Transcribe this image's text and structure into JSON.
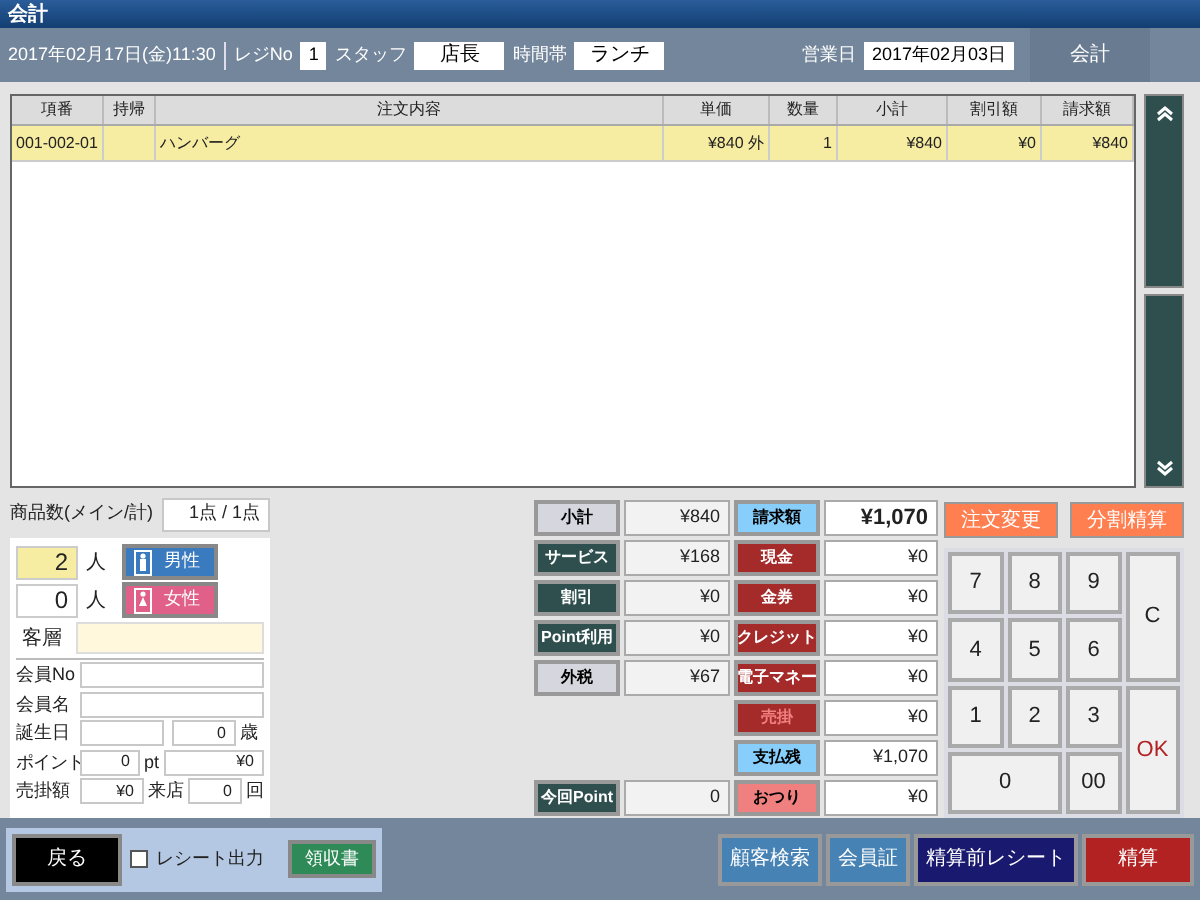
{
  "window": {
    "title": "会計"
  },
  "header": {
    "datetime": "2017年02月17日(金)11:30",
    "register_label": "レジNo",
    "register": "1",
    "staff_label": "スタッフ",
    "staff": "店長",
    "time_slot_label": "時間帯",
    "time_slot": "ランチ",
    "business_date_label": "営業日",
    "business_date": "2017年02月03日",
    "mode": "会計"
  },
  "table": {
    "columns": [
      "項番",
      "持帰",
      "注文内容",
      "単価",
      "数量",
      "小計",
      "割引額",
      "請求額"
    ],
    "rows": [
      {
        "selected": true,
        "cells": [
          "001-002-01",
          "",
          "ハンバーグ",
          "¥840 外",
          "1",
          "¥840",
          "¥0",
          "¥840"
        ]
      }
    ]
  },
  "item_count": {
    "label": "商品数(メイン/計)",
    "value": "1点 / 1点"
  },
  "guests": [
    {
      "count": "2",
      "unit": "人",
      "selected": true,
      "kind": "male",
      "button": "男性"
    },
    {
      "count": "0",
      "unit": "人",
      "selected": false,
      "kind": "female",
      "button": "女性"
    }
  ],
  "segment": {
    "label": "客層"
  },
  "member": {
    "no_label": "会員No",
    "name_label": "会員名",
    "birthday_label": "誕生日",
    "age": "0",
    "age_unit": "歳",
    "point_label": "ポイント",
    "points": "0",
    "point_unit": "pt",
    "point_value": "¥0",
    "credit_label": "売掛額",
    "credit": "¥0",
    "visits_label": "来店",
    "visits": "0",
    "visits_unit": "回"
  },
  "payment_grid": [
    {
      "left": {
        "label": "小計",
        "kind": "total",
        "value": "¥840"
      },
      "right": {
        "label": "請求額",
        "kind": "info",
        "value": "¥1,070",
        "emphasis": true,
        "disabled": false
      }
    },
    {
      "left": {
        "label": "サービス",
        "kind": "action",
        "value": "¥168"
      },
      "right": {
        "label": "現金",
        "kind": "tender",
        "value": "¥0",
        "emphasis": false,
        "disabled": false
      }
    },
    {
      "left": {
        "label": "割引",
        "kind": "action",
        "value": "¥0"
      },
      "right": {
        "label": "金券",
        "kind": "tender",
        "value": "¥0",
        "emphasis": false,
        "disabled": false
      }
    },
    {
      "left": {
        "label": "Point利用",
        "kind": "action",
        "value": "¥0"
      },
      "right": {
        "label": "クレジット",
        "kind": "tender",
        "value": "¥0",
        "emphasis": false,
        "disabled": false
      }
    },
    {
      "left": {
        "label": "外税",
        "kind": "total",
        "value": "¥67"
      },
      "right": {
        "label": "電子マネー",
        "kind": "tender",
        "value": "¥0",
        "emphasis": false,
        "disabled": false
      }
    },
    {
      "right": {
        "label": "売掛",
        "kind": "tender",
        "value": "¥0",
        "emphasis": false,
        "disabled": true
      }
    },
    {
      "right": {
        "label": "支払残",
        "kind": "info",
        "value": "¥1,070",
        "emphasis": false,
        "disabled": false
      }
    },
    {
      "left": {
        "label": "今回Point",
        "kind": "action",
        "value": "0"
      },
      "right": {
        "label": "おつり",
        "kind": "change",
        "value": "¥0",
        "emphasis": false,
        "disabled": false
      }
    }
  ],
  "side_buttons": [
    "注文変更",
    "分割精算"
  ],
  "keypad": [
    {
      "label": "7",
      "kind": "digit"
    },
    {
      "label": "8",
      "kind": "digit"
    },
    {
      "label": "9",
      "kind": "digit"
    },
    {
      "label": "C",
      "kind": "clear"
    },
    {
      "label": "4",
      "kind": "digit"
    },
    {
      "label": "5",
      "kind": "digit"
    },
    {
      "label": "6",
      "kind": "digit"
    },
    {
      "label": "1",
      "kind": "digit"
    },
    {
      "label": "2",
      "kind": "digit"
    },
    {
      "label": "3",
      "kind": "digit"
    },
    {
      "label": "OK",
      "kind": "ok"
    },
    {
      "label": "0",
      "kind": "zero"
    },
    {
      "label": "00",
      "kind": "digit"
    }
  ],
  "footer": {
    "back": "戻る",
    "receipt_output": {
      "label": "レシート出力",
      "checked": false
    },
    "receipt": "領収書",
    "actions": [
      {
        "label": "顧客検索",
        "kind": "info"
      },
      {
        "label": "会員証",
        "kind": "info"
      },
      {
        "label": "精算前レシート",
        "kind": "navy"
      },
      {
        "label": "精算",
        "kind": "danger"
      }
    ]
  }
}
